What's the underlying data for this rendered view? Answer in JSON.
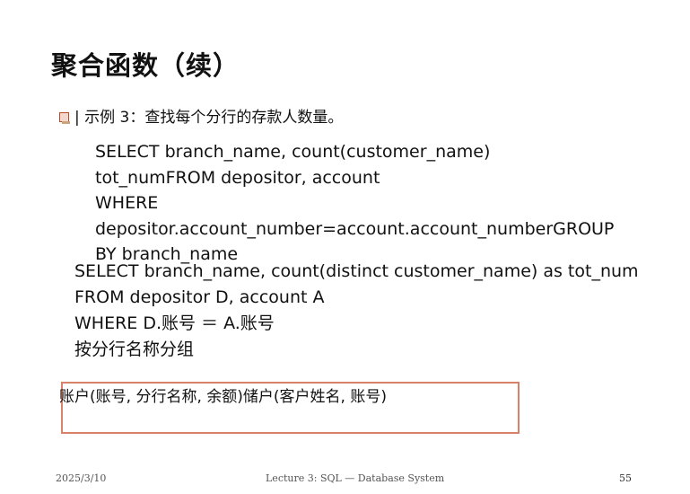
{
  "slide": {
    "title": "聚合函数（续）",
    "bullet": "| 示例 3：查找每个分行的存款人数量。",
    "query1_lines": [
      "SELECT branch_name, count(customer_name)",
      "tot_numFROM depositor, account",
      "WHERE",
      "depositor.account_number=account.account_numberGROUP",
      "BY branch_name"
    ],
    "query2_lines": [
      "SELECT branch_name, count(distinct customer_name) as tot_num",
      "FROM depositor D, account A",
      "WHERE D.账号 ＝ A.账号",
      "按分行名称分组"
    ],
    "schema_text": "账户(账号, 分行名称, 余额)储户(客户姓名, 账号)"
  },
  "footer": {
    "date": "2025/3/10",
    "center": "Lecture 3: SQL — Database System",
    "page": "55"
  },
  "colors": {
    "box_border": "#d9826a",
    "bullet_border": "#b84a2a"
  }
}
